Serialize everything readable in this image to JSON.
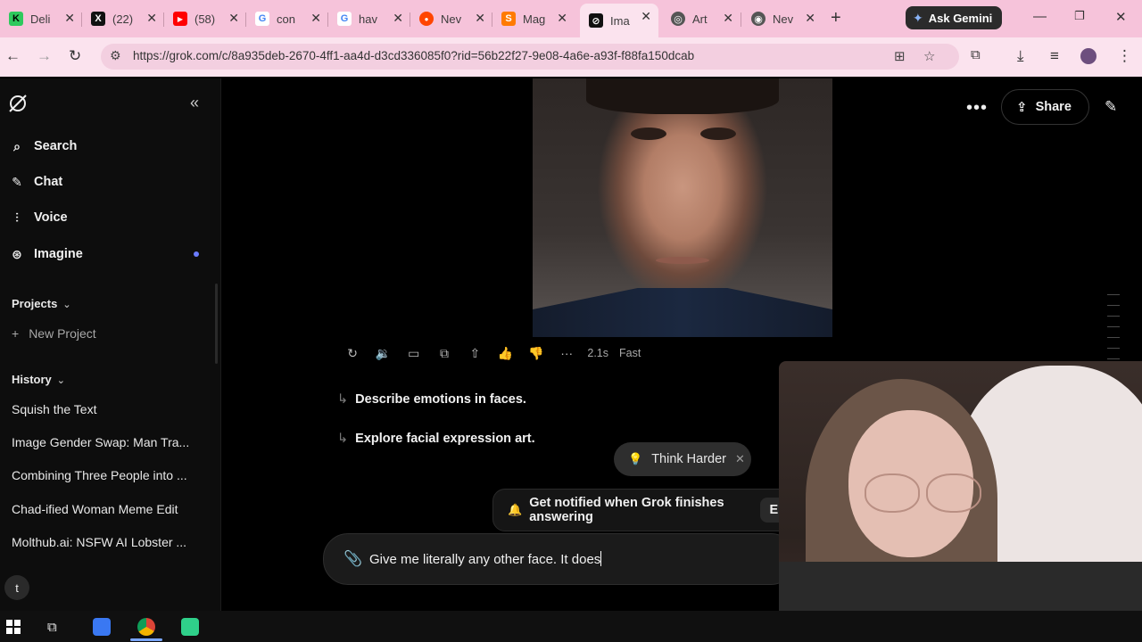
{
  "browser": {
    "tabs": [
      {
        "title": "Deli",
        "favicon": "K",
        "color": "#2ec95d",
        "active": false
      },
      {
        "title": "(22)",
        "favicon": "X",
        "color": "#111111",
        "active": false
      },
      {
        "title": "(58)",
        "favicon": "▶",
        "color": "#ff0000",
        "active": false
      },
      {
        "title": "con",
        "favicon": "G",
        "color": "#ffffff",
        "active": false
      },
      {
        "title": "hav",
        "favicon": "G",
        "color": "#ffffff",
        "active": false
      },
      {
        "title": "Nev",
        "favicon": "●",
        "color": "#ff4500",
        "active": false
      },
      {
        "title": "Mag",
        "favicon": "S",
        "color": "#ff7a00",
        "active": false
      },
      {
        "title": "Ima",
        "favicon": "⊘",
        "color": "#111111",
        "active": true
      },
      {
        "title": "Art",
        "favicon": "◎",
        "color": "#444444",
        "active": false
      },
      {
        "title": "Nev",
        "favicon": "◉",
        "color": "#444444",
        "active": false
      }
    ],
    "new_tab": "+",
    "gemini_label": "Ask Gemini",
    "url": "https://grok.com/c/8a935deb-2670-4ff1-aa4d-d3cd336085f0?rid=56b22f27-9e08-4a6e-a93f-f88fa150dcab"
  },
  "sidebar": {
    "nav": [
      {
        "label": "Search",
        "icon": "search-icon",
        "glyph": "⌕"
      },
      {
        "label": "Chat",
        "icon": "chat-icon",
        "glyph": "✎"
      },
      {
        "label": "Voice",
        "icon": "voice-icon",
        "glyph": "⫶"
      },
      {
        "label": "Imagine",
        "icon": "imagine-icon",
        "glyph": "⊛"
      }
    ],
    "projects_label": "Projects",
    "new_project_label": "New Project",
    "history_label": "History",
    "history": [
      "Squish the Text",
      "Image Gender Swap: Man Tra...",
      "Combining Three People into ...",
      "Chad-ified Woman Meme Edit",
      "Molthub.ai: NSFW AI Lobster ..."
    ],
    "user_initial": "t"
  },
  "header": {
    "share_label": "Share"
  },
  "response": {
    "time": "2.1s",
    "mode": "Fast",
    "suggestions": [
      "Describe emotions in faces.",
      "Explore facial expression art."
    ]
  },
  "think_harder": {
    "label": "Think Harder"
  },
  "notify": {
    "label": "Get notified when Grok finishes answering",
    "button": "En"
  },
  "composer": {
    "value": "Give me literally any other face.  It does"
  }
}
